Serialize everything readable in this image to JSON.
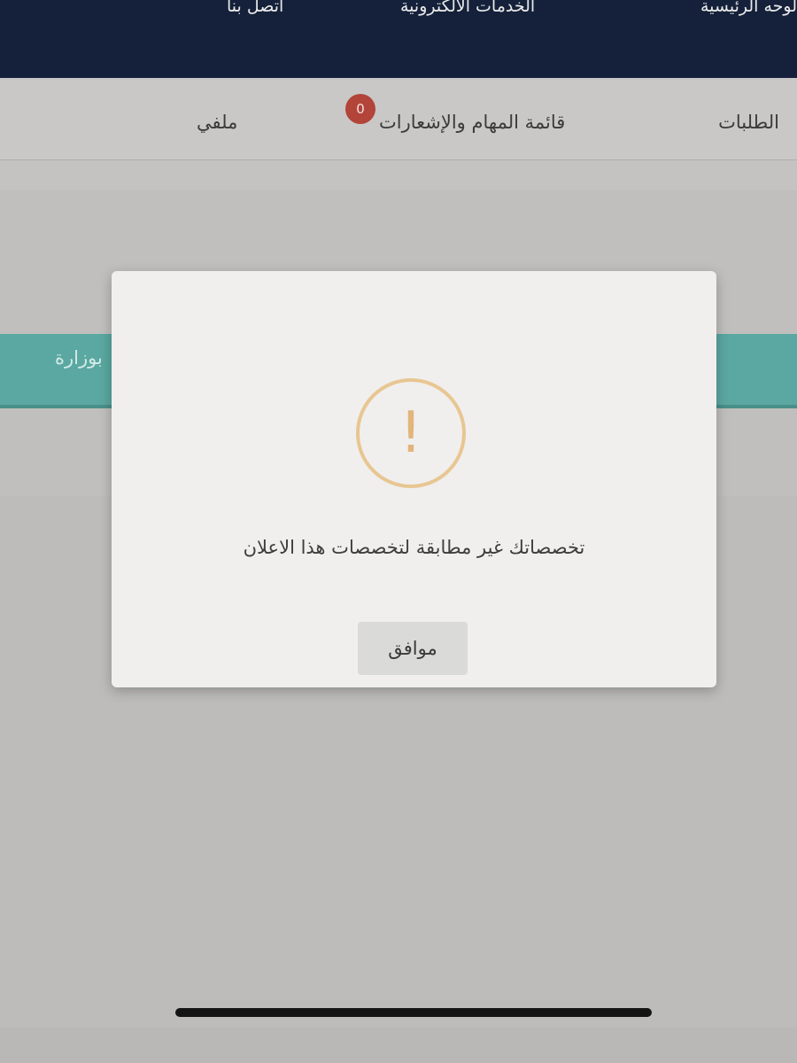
{
  "top_nav": {
    "items": [
      "لوحه الرئيسية",
      "الخدمات الالكترونية",
      "اتصل بنا"
    ]
  },
  "sub_nav": {
    "tabs": [
      "الطلبات",
      "قائمة المهام والإشعارات",
      "ملفي"
    ],
    "notification_count": "0"
  },
  "background": {
    "strip_text": "بوزارة"
  },
  "dialog": {
    "icon": "warning-icon",
    "message": "تخصصاتك غير مطابقة لتخصصات هذا الاعلان",
    "confirm_label": "موافق",
    "icon_color": "#e8c692"
  },
  "colors": {
    "nav_bg": "#15213a",
    "accent_teal": "#5aa8a1",
    "badge_red": "#b2443a"
  }
}
